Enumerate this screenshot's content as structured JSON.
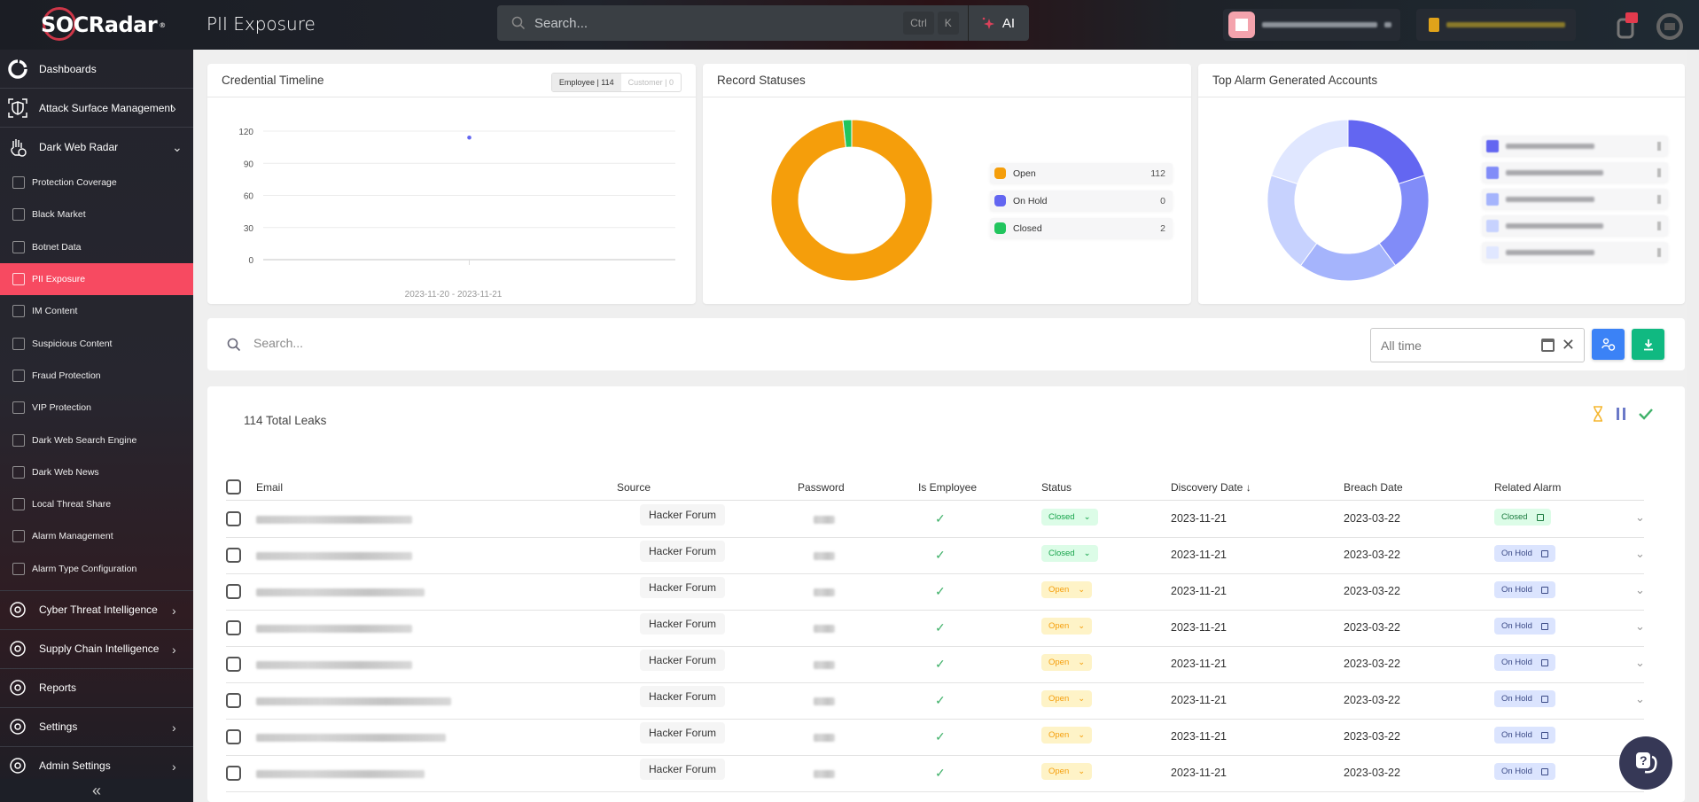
{
  "header": {
    "brand": "SOCRadar",
    "page_title": "PII Exposure",
    "search_placeholder": "Search...",
    "shortcut_keys": [
      "Ctrl",
      "K"
    ],
    "ai_label": "AI"
  },
  "sidebar": {
    "top_items": [
      {
        "label": "Dashboards",
        "icon": "dashboard-icon",
        "expandable": false
      },
      {
        "label": "Attack Surface Management",
        "icon": "shield-scan-icon",
        "expandable": true
      },
      {
        "label": "Dark Web Radar",
        "icon": "hand-icon",
        "expandable": true,
        "expanded": true
      }
    ],
    "sub_items": [
      {
        "label": "Protection Coverage",
        "icon": "laptop-icon"
      },
      {
        "label": "Black Market",
        "icon": "market-icon"
      },
      {
        "label": "Botnet Data",
        "icon": "bug-icon"
      },
      {
        "label": "PII Exposure",
        "icon": "id-card-icon",
        "active": true
      },
      {
        "label": "IM Content",
        "icon": "chat-icon"
      },
      {
        "label": "Suspicious Content",
        "icon": "document-icon"
      },
      {
        "label": "Fraud Protection",
        "icon": "fraud-icon"
      },
      {
        "label": "VIP Protection",
        "icon": "vip-icon"
      },
      {
        "label": "Dark Web Search Engine",
        "icon": "search-icon"
      },
      {
        "label": "Dark Web News",
        "icon": "news-icon"
      },
      {
        "label": "Local Threat Share",
        "icon": "share-icon"
      },
      {
        "label": "Alarm Management",
        "icon": "alarm-icon"
      },
      {
        "label": "Alarm Type Configuration",
        "icon": "alarm-config-icon"
      }
    ],
    "bottom_items": [
      {
        "label": "Cyber Threat Intelligence",
        "icon": "eye-shield-icon",
        "expandable": true
      },
      {
        "label": "Supply Chain Intelligence",
        "icon": "building-icon",
        "expandable": true
      },
      {
        "label": "Reports",
        "icon": "report-icon",
        "expandable": false
      },
      {
        "label": "Settings",
        "icon": "gears-icon",
        "expandable": true
      },
      {
        "label": "Admin Settings",
        "icon": "admin-icon",
        "expandable": true
      }
    ],
    "collapse_glyph": "«"
  },
  "credential_timeline": {
    "title": "Credential Timeline",
    "toggle": {
      "employee": "Employee | 114",
      "customer": "Customer | 0"
    }
  },
  "record_statuses": {
    "title": "Record Statuses",
    "items": [
      {
        "label": "Open",
        "value": "112",
        "color": "#f59e0b"
      },
      {
        "label": "On Hold",
        "value": "0",
        "color": "#6366f1"
      },
      {
        "label": "Closed",
        "value": "2",
        "color": "#22c55e"
      }
    ]
  },
  "top_alarm_accounts": {
    "title": "Top Alarm Generated Accounts",
    "colors": [
      "#6366f1",
      "#818cf8",
      "#a5b4fc",
      "#c7d2fe",
      "#e0e7ff"
    ]
  },
  "chart_data": [
    {
      "type": "scatter",
      "title": "Credential Timeline",
      "x": [
        "2023-11-20 - 2023-11-21"
      ],
      "series": [
        {
          "name": "Employee",
          "values": [
            114
          ]
        }
      ],
      "yticks": [
        0,
        30,
        60,
        90,
        120
      ],
      "ylim": [
        0,
        120
      ],
      "xlabel": "2023-11-20 - 2023-11-21",
      "ylabel": "",
      "grid": true,
      "point_color": "#6366f1"
    },
    {
      "type": "pie",
      "title": "Record Statuses",
      "donut": true,
      "categories": [
        "Open",
        "On Hold",
        "Closed"
      ],
      "values": [
        112,
        0,
        2
      ],
      "colors": [
        "#f59e0b",
        "#6366f1",
        "#22c55e"
      ],
      "legend": "right"
    },
    {
      "type": "pie",
      "title": "Top Alarm Generated Accounts",
      "donut": true,
      "categories": [
        "account-1 (redacted)",
        "account-2 (redacted)",
        "account-3 (redacted)",
        "account-4 (redacted)",
        "account-5 (redacted)"
      ],
      "values": [
        1,
        1,
        1,
        1,
        1
      ],
      "colors": [
        "#6366f1",
        "#818cf8",
        "#a5b4fc",
        "#c7d2fe",
        "#e0e7ff"
      ],
      "legend": "right"
    }
  ],
  "filters": {
    "search_placeholder": "Search...",
    "date_placeholder": "All time"
  },
  "table": {
    "total_label": "114 Total Leaks",
    "columns": [
      "Email",
      "Source",
      "Password",
      "Is Employee",
      "Status",
      "Discovery Date",
      "Breach Date",
      "Related Alarm"
    ],
    "sort_indicator": "↓",
    "rows": [
      {
        "source": "Hacker Forum",
        "status": "Closed",
        "discovery": "2023-11-21",
        "breach": "2023-03-22",
        "alarm": "Closed"
      },
      {
        "source": "Hacker Forum",
        "status": "Closed",
        "discovery": "2023-11-21",
        "breach": "2023-03-22",
        "alarm": "On Hold"
      },
      {
        "source": "Hacker Forum",
        "status": "Open",
        "discovery": "2023-11-21",
        "breach": "2023-03-22",
        "alarm": "On Hold"
      },
      {
        "source": "Hacker Forum",
        "status": "Open",
        "discovery": "2023-11-21",
        "breach": "2023-03-22",
        "alarm": "On Hold"
      },
      {
        "source": "Hacker Forum",
        "status": "Open",
        "discovery": "2023-11-21",
        "breach": "2023-03-22",
        "alarm": "On Hold"
      },
      {
        "source": "Hacker Forum",
        "status": "Open",
        "discovery": "2023-11-21",
        "breach": "2023-03-22",
        "alarm": "On Hold"
      },
      {
        "source": "Hacker Forum",
        "status": "Open",
        "discovery": "2023-11-21",
        "breach": "2023-03-22",
        "alarm": "On Hold"
      },
      {
        "source": "Hacker Forum",
        "status": "Open",
        "discovery": "2023-11-21",
        "breach": "2023-03-22",
        "alarm": "On Hold"
      }
    ]
  }
}
